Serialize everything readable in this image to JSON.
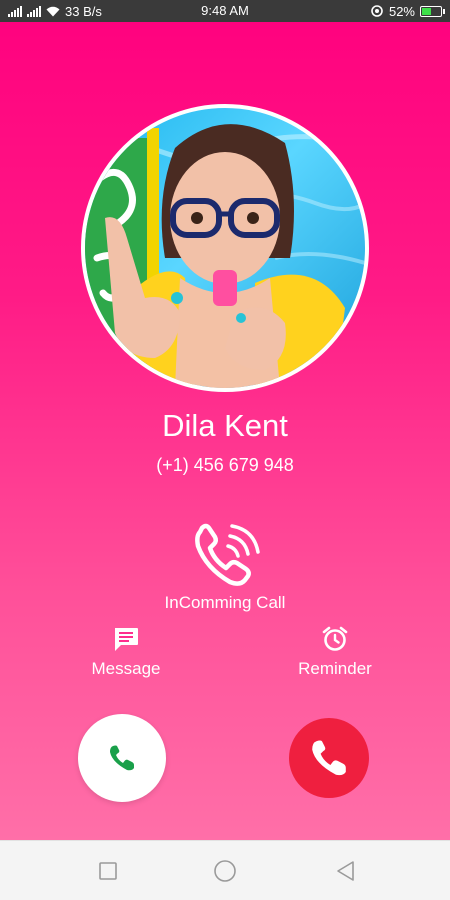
{
  "status_bar": {
    "network_speed": "33 B/s",
    "time": "9:48 AM",
    "battery_percent": "52%",
    "battery_level": 0.52
  },
  "caller": {
    "name": "Dila Kent",
    "number": "(+1) 456 679 948"
  },
  "call_status": "InComming Call",
  "actions": {
    "message_label": "Message",
    "reminder_label": "Reminder"
  },
  "colors": {
    "background_top": "#ff007e",
    "background_bottom": "#ff6fa8",
    "accept_icon": "#1aa04a",
    "decline_button": "#ef1f3f"
  },
  "icons": {
    "ringing": "phone-ringing-icon",
    "message": "message-icon",
    "reminder": "alarm-clock-icon",
    "accept": "phone-icon",
    "decline": "phone-icon"
  }
}
